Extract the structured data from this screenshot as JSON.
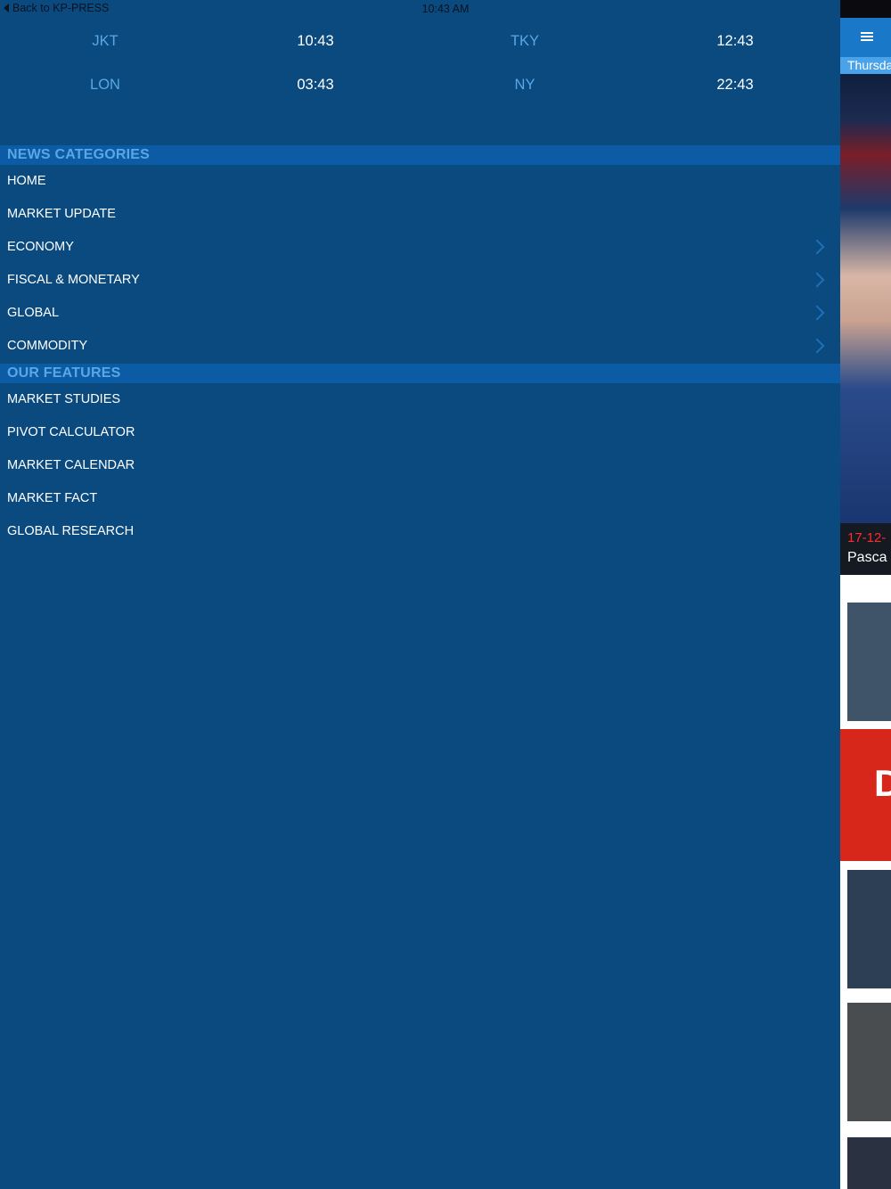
{
  "status_bar": {
    "back_label": "Back to KP-PRESS",
    "time": "10:43 AM"
  },
  "clocks": [
    {
      "city": "JKT",
      "time": "10:43"
    },
    {
      "city": "TKY",
      "time": "12:43"
    },
    {
      "city": "LON",
      "time": "03:43"
    },
    {
      "city": "NY",
      "time": "22:43"
    }
  ],
  "news_categories": {
    "title": "NEWS CATEGORIES",
    "items": [
      {
        "label": "HOME",
        "has_submenu": false
      },
      {
        "label": "MARKET UPDATE",
        "has_submenu": false
      },
      {
        "label": "ECONOMY",
        "has_submenu": true
      },
      {
        "label": "FISCAL & MONETARY",
        "has_submenu": true
      },
      {
        "label": "GLOBAL",
        "has_submenu": true
      },
      {
        "label": "COMMODITY",
        "has_submenu": true
      }
    ]
  },
  "our_features": {
    "title": "OUR FEATURES",
    "items": [
      {
        "label": "MARKET STUDIES"
      },
      {
        "label": "PIVOT CALCULATOR"
      },
      {
        "label": "MARKET CALENDAR"
      },
      {
        "label": "MARKET FACT"
      },
      {
        "label": "GLOBAL RESEARCH"
      }
    ]
  },
  "peek": {
    "date_strip": "Thursda",
    "hero_date": "17-12-",
    "hero_text": "Pasca",
    "banner_letter": "D"
  },
  "colors": {
    "drawer_bg": "#0a4a7f",
    "section_bg": "#0b5ca5",
    "accent": "#5aa7e6",
    "nav_bar": "#1a78c9"
  },
  "icons": {
    "back": "chevron-left-icon",
    "submenu": "chevron-right-icon",
    "menu": "hamburger-menu-icon"
  }
}
